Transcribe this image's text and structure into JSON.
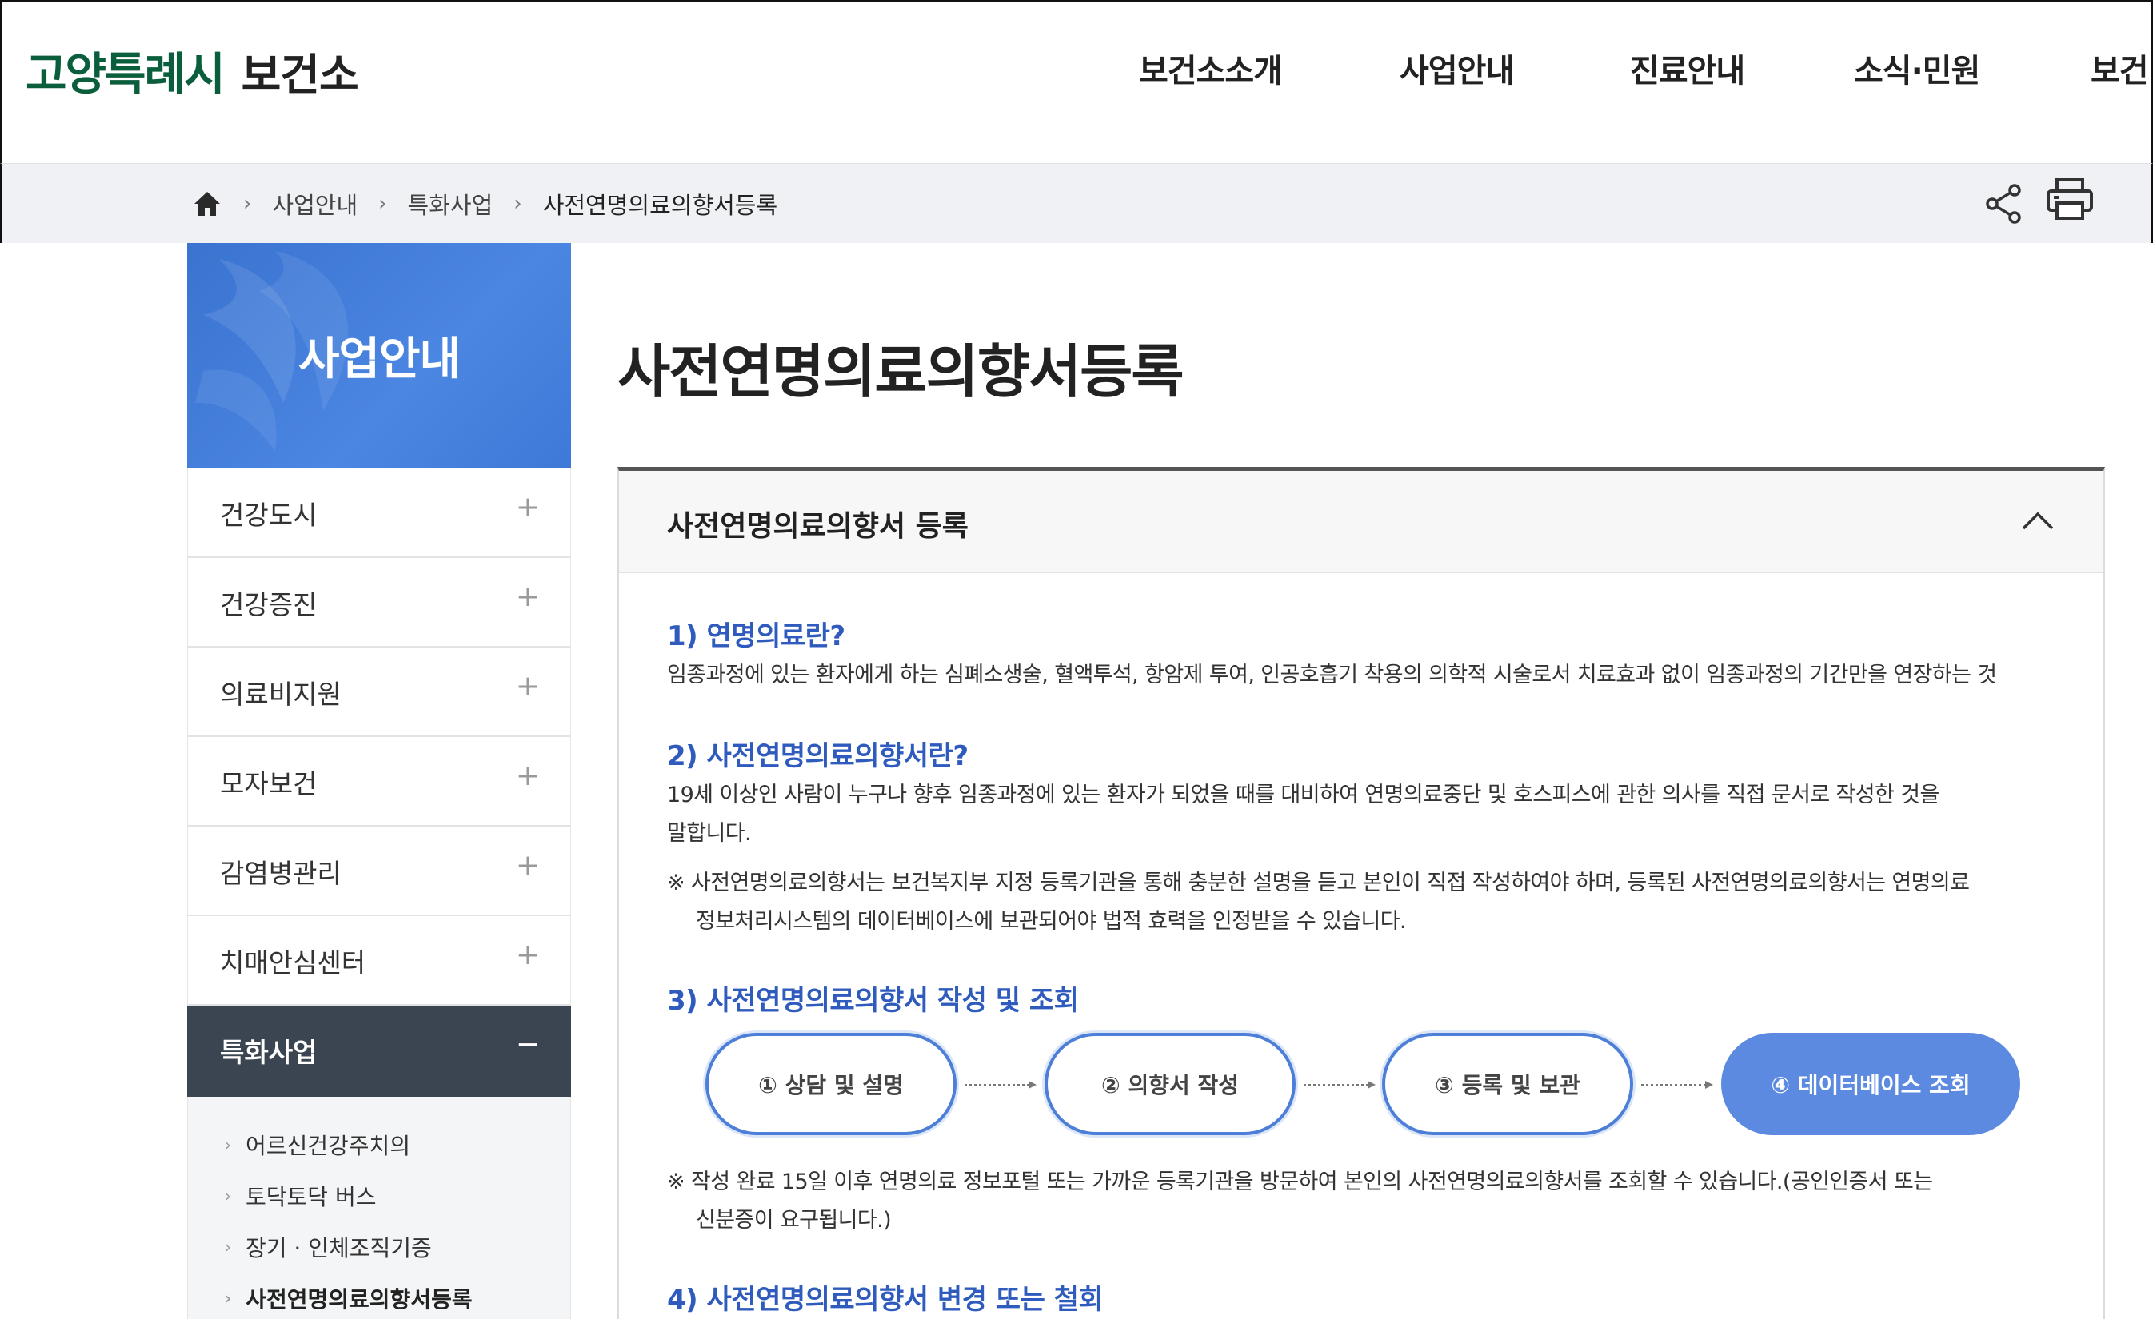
{
  "header": {
    "logo_city": "고양특례시",
    "logo_org": "보건소",
    "nav": [
      "보건소소개",
      "사업안내",
      "진료안내",
      "소식·민원",
      "보건"
    ]
  },
  "breadcrumb": {
    "items": [
      "사업안내",
      "특화사업",
      "사전연명의료의향서등록"
    ]
  },
  "lnb": {
    "title": "사업안내",
    "items": [
      {
        "label": "건강도시",
        "toggle": "+"
      },
      {
        "label": "건강증진",
        "toggle": "+"
      },
      {
        "label": "의료비지원",
        "toggle": "+"
      },
      {
        "label": "모자보건",
        "toggle": "+"
      },
      {
        "label": "감염병관리",
        "toggle": "+"
      },
      {
        "label": "치매안심센터",
        "toggle": "+"
      },
      {
        "label": "특화사업",
        "toggle": "−"
      }
    ],
    "sub_items": [
      "어르신건강주치의",
      "토닥토닥 버스",
      "장기 · 인체조직기증",
      "사전연명의료의향서등록"
    ]
  },
  "main": {
    "page_title": "사전연명의료의향서등록",
    "panel_title": "사전연명의료의향서 등록",
    "sections": {
      "s1_title": "1) 연명의료란?",
      "s1_text": "임종과정에 있는 환자에게 하는 심폐소생술, 혈액투석, 항암제 투여, 인공호흡기 착용의 의학적 시술로서 치료효과 없이 임종과정의 기간만을 연장하는 것",
      "s2_title": "2) 사전연명의료의향서란?",
      "s2_text_1": "19세 이상인 사람이 누구나 향후 임종과정에 있는 환자가 되었을 때를 대비하여 연명의료중단 및 호스피스에 관한 의사를 직접 문서로 작성한 것을",
      "s2_text_2": "말합니다.",
      "s2_note_1": "※ 사전연명의료의향서는 보건복지부 지정 등록기관을 통해 충분한 설명을 듣고 본인이 직접 작성하여야 하며, 등록된 사전연명의료의향서는 연명의료",
      "s2_note_2": "정보처리시스템의 데이터베이스에 보관되어야 법적 효력을 인정받을 수 있습니다.",
      "s3_title": "3) 사전연명의료의향서 작성 및 조회",
      "steps": [
        "① 상담 및 설명",
        "② 의향서 작성",
        "③ 등록 및 보관",
        "④ 데이터베이스 조회"
      ],
      "s3_note_1": "※ 작성 완료 15일 이후 연명의료 정보포털 또는 가까운 등록기관을 방문하여 본인의 사전연명의료의향서를 조회할 수 있습니다.(공인인증서 또는",
      "s3_note_2": "신분증이 요구됩니다.)",
      "s4_title": "4) 사전연명의료의향서 변경 또는 철회"
    }
  },
  "colors": {
    "logo_green": "#0b5e3c",
    "accent_blue": "#2e5bbd",
    "lnb_banner": "#4a84e0",
    "lnb_active": "#3a4551",
    "step_fill": "#5b8ae0"
  },
  "icons": {
    "home": "home-icon",
    "share": "share-icon",
    "print": "print-icon",
    "collapse": "chevron-up-icon"
  }
}
